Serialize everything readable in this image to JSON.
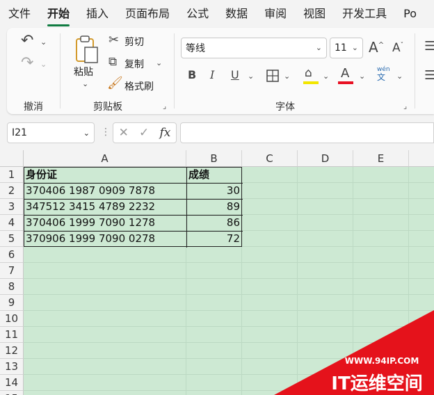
{
  "ribbon_tabs": [
    "文件",
    "开始",
    "插入",
    "页面布局",
    "公式",
    "数据",
    "审阅",
    "视图",
    "开发工具",
    "Po"
  ],
  "active_tab": "开始",
  "undo_group": {
    "label": "撤消"
  },
  "clipboard": {
    "paste": "粘贴",
    "cut": "剪切",
    "copy": "复制",
    "format_painter": "格式刷",
    "label": "剪贴板"
  },
  "font": {
    "name": "等线",
    "size": "11",
    "grow": "A",
    "shrink": "A",
    "bold": "B",
    "italic": "I",
    "underline": "U",
    "color_letter": "A",
    "phonetic_top": "wén",
    "phonetic_bottom": "文",
    "label": "字体",
    "fill_color": "#f2e600",
    "font_color": "#e81123"
  },
  "formula_bar": {
    "name_box": "I21",
    "fx": "fx",
    "value": ""
  },
  "columns": [
    "A",
    "B",
    "C",
    "D",
    "E"
  ],
  "rows": [
    "1",
    "2",
    "3",
    "4",
    "5",
    "6",
    "7",
    "8",
    "9",
    "10",
    "11",
    "12",
    "13",
    "14",
    "15"
  ],
  "table": {
    "headers": [
      "身份证",
      "成绩"
    ],
    "rows": [
      [
        "370406 1987 0909 7878",
        "30"
      ],
      [
        "347512 3415 4789 2232",
        "89"
      ],
      [
        "370406 1999 7090 1278",
        "86"
      ],
      [
        "370906 1999 7090 0278",
        "72"
      ]
    ]
  },
  "watermark": {
    "url": "WWW.94IP.COM",
    "brand": "IT运维空间",
    "color": "#e5121b"
  },
  "sheet_fill": "#cde9d3"
}
